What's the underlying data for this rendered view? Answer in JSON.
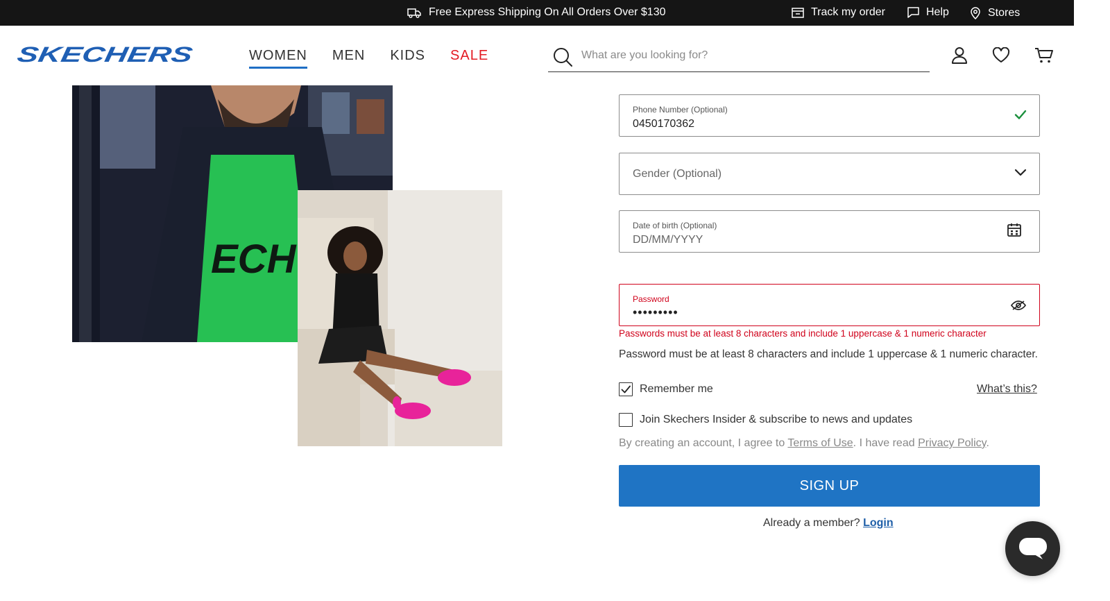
{
  "topbar": {
    "promo_text": "Free Express Shipping On All Orders Over $130",
    "track_label": "Track my order",
    "help_label": "Help",
    "stores_label": "Stores"
  },
  "header": {
    "logo_text": "SKECHERS",
    "nav": [
      {
        "label": "WOMEN",
        "active": true
      },
      {
        "label": "MEN",
        "active": false
      },
      {
        "label": "KIDS",
        "active": false
      },
      {
        "label": "SALE",
        "active": false,
        "color": "#e31b23"
      }
    ],
    "search_placeholder": "What are you looking for?",
    "icons": [
      "account-icon",
      "wishlist-heart-icon",
      "cart-icon"
    ]
  },
  "form": {
    "phone": {
      "label": "Phone Number (Optional)",
      "value": "0450170362",
      "status": "valid"
    },
    "gender": {
      "placeholder": "Gender (Optional)"
    },
    "dob": {
      "label": "Date of birth (Optional)",
      "value": "DD/MM/YYYY"
    },
    "password": {
      "label": "Password",
      "value": "•••••••••",
      "error": "Passwords must be at least 8 characters and include 1 uppercase & 1 numeric character",
      "hint": "Password must be at least 8 characters and include 1 uppercase & 1 numeric character."
    },
    "remember_me": {
      "label": "Remember me",
      "checked": true
    },
    "whats_this": "What’s this?",
    "insider": {
      "label": "Join Skechers Insider & subscribe to news and updates",
      "checked": false
    },
    "terms": {
      "prefix": "By creating an account, I agree to ",
      "terms_link": "Terms of Use",
      "middle": ". I have read ",
      "privacy_link": "Privacy Policy",
      "suffix": "."
    },
    "signup_label": "SIGN UP",
    "already_member": "Already a member?",
    "login_link": "Login"
  },
  "colors": {
    "brand_blue": "#1f74c4",
    "error_red": "#d0021b",
    "sale_red": "#e31b23",
    "valid_green": "#1a8f3c"
  }
}
